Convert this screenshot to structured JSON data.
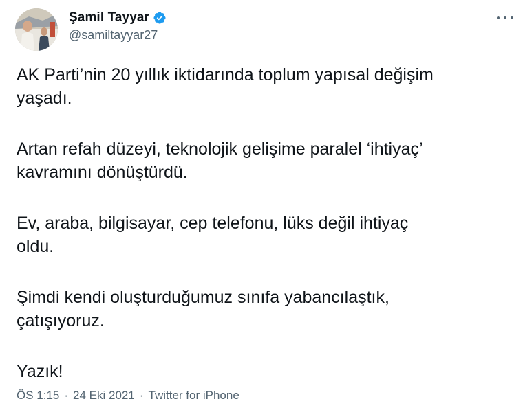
{
  "author": {
    "display_name": "Şamil Tayyar",
    "handle": "@samiltayyar27",
    "verified": true
  },
  "tweet": {
    "paragraphs": [
      "AK Parti’nin 20 yıllık iktidarında toplum yapısal değişim\nyaşadı.",
      "Artan refah düzeyi, teknolojik gelişime paralel ‘ihtiyaç’\nkavramını dönüştürdü.",
      "Ev, araba, bilgisayar, cep telefonu, lüks değil ihtiyaç\noldu.",
      "Şimdi kendi oluşturduğumuz sınıfa yabancılaştık,\nçatışıyoruz.",
      "Yazık!"
    ]
  },
  "meta": {
    "time": "ÖS 1:15",
    "separator": "·",
    "date": "24 Eki 2021",
    "source": "Twitter for iPhone"
  },
  "icons": {
    "verified": "verified-badge-icon",
    "more": "more-options-icon"
  },
  "colors": {
    "verified_blue": "#1d9bf0",
    "text_primary": "#0f1419",
    "text_secondary": "#536471"
  }
}
